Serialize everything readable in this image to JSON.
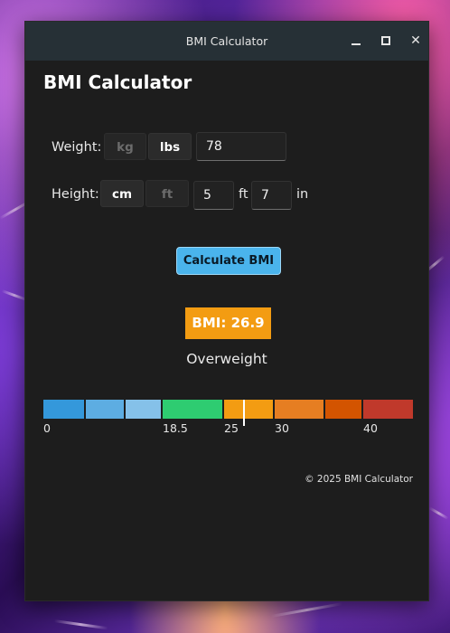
{
  "window": {
    "title": "BMI Calculator",
    "controls": {
      "minimize": "minimize-icon",
      "maximize": "maximize-icon",
      "close": "close-icon"
    }
  },
  "app": {
    "heading": "BMI Calculator"
  },
  "weight": {
    "label": "Weight:",
    "unit_options": [
      "kg",
      "lbs"
    ],
    "selected_unit": "lbs",
    "value": "78"
  },
  "height": {
    "label": "Height:",
    "unit_options": [
      "cm",
      "ft"
    ],
    "selected_unit": "cm",
    "feet_value": "5",
    "feet_suffix": "ft",
    "inches_value": "7",
    "inches_suffix": "in"
  },
  "calculate_label": "Calculate BMI",
  "result": {
    "bmi_text": "BMI: 26.9",
    "bmi_value": 26.9,
    "category": "Overweight",
    "badge_color": "#f39c12"
  },
  "scale": {
    "colors": [
      "#3498db",
      "#5dade2",
      "#85c1e9",
      "#2ecc71",
      "#f39c12",
      "#e67e22",
      "#d35400",
      "#c0392b"
    ],
    "ticks": [
      "0",
      "18.5",
      "25",
      "30",
      "40"
    ],
    "marker_value": 26.9
  },
  "footer": "© 2025 BMI Calculator"
}
